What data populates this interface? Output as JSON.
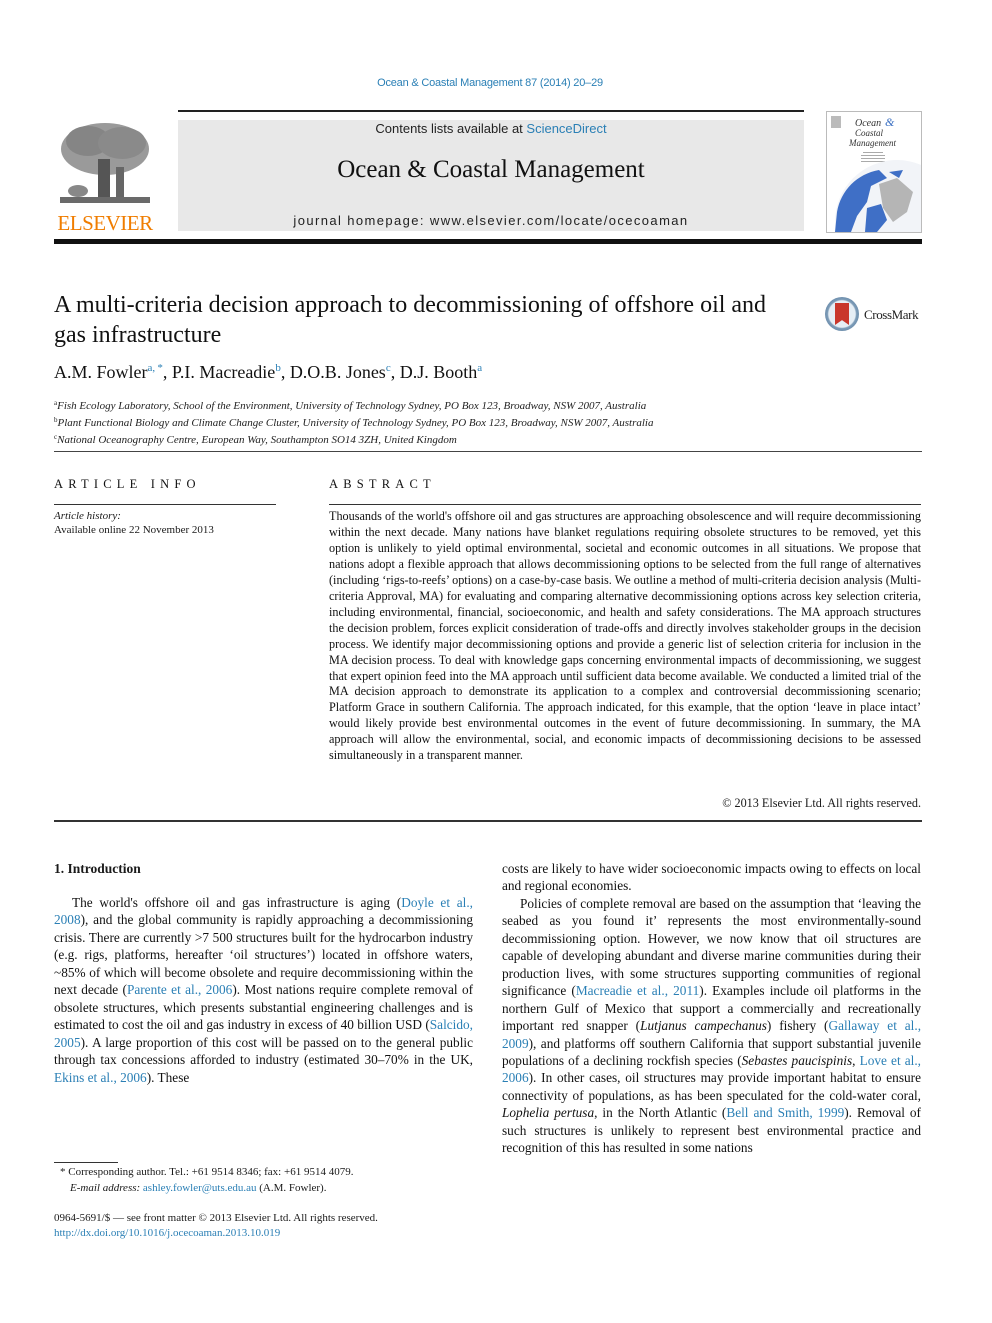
{
  "running_head": "Ocean & Coastal Management 87 (2014) 20–29",
  "masthead": {
    "contents_prefix": "Contents lists available at ",
    "contents_link": "ScienceDirect",
    "journal_title": "Ocean & Coastal Management",
    "homepage": "journal homepage: www.elsevier.com/locate/ocecoaman",
    "publisher_logo_text": "ELSEVIER",
    "cover_title_lines": [
      "Ocean",
      "Coastal",
      "Management"
    ],
    "cover_amp": "&"
  },
  "crossmark_label": "CrossMark",
  "article": {
    "title": "A multi-criteria decision approach to decommissioning of offshore oil and gas infrastructure",
    "authors": [
      {
        "name": "A.M. Fowler",
        "sup": "a, *",
        "sep": ", "
      },
      {
        "name": "P.I. Macreadie",
        "sup": "b",
        "sep": ", "
      },
      {
        "name": "D.O.B. Jones",
        "sup": "c",
        "sep": ", "
      },
      {
        "name": "D.J. Booth",
        "sup": "a",
        "sep": ""
      }
    ],
    "affiliations": [
      {
        "sup": "a",
        "text": "Fish Ecology Laboratory, School of the Environment, University of Technology Sydney, PO Box 123, Broadway, NSW 2007, Australia"
      },
      {
        "sup": "b",
        "text": "Plant Functional Biology and Climate Change Cluster, University of Technology Sydney, PO Box 123, Broadway, NSW 2007, Australia"
      },
      {
        "sup": "c",
        "text": "National Oceanography Centre, European Way, Southampton SO14 3ZH, United Kingdom"
      }
    ]
  },
  "article_info": {
    "heading": "ARTICLE INFO",
    "history_label": "Article history:",
    "history_value": "Available online 22 November 2013"
  },
  "abstract": {
    "heading": "ABSTRACT",
    "text": "Thousands of the world's offshore oil and gas structures are approaching obsolescence and will require decommissioning within the next decade. Many nations have blanket regulations requiring obsolete structures to be removed, yet this option is unlikely to yield optimal environmental, societal and eco­nomic outcomes in all situations. We propose that nations adopt a flexible approach that allows decommissioning options to be selected from the full range of alternatives (including ‘rigs-to-reefs’ options) on a case-by-case basis. We outline a method of multi-criteria decision analysis (Multi-criteria Approval, MA) for evaluating and comparing alternative decommissioning options across key selection criteria, including environmental, financial, socioeconomic, and health and safety considerations. The MA approach structures the decision problem, forces explicit consideration of trade-offs and directly involves stakeholder groups in the decision process. We identify major decommissioning options and provide a generic list of selection criteria for inclusion in the MA decision process. To deal with knowledge gaps concerning environmental impacts of decommissioning, we suggest that expert opinion feed into the MA approach until sufficient data become available. We conducted a limited trial of the MA decision approach to demonstrate its application to a complex and controversial decommissioning scenario; Platform Grace in southern California. The approach indicated, for this example, that the option ‘leave in place intact’ would likely provide best environmental outcomes in the event of future decommissioning. In summary, the MA approach will allow the environmental, social, and economic impacts of decom­missioning decisions to be assessed simultaneously in a transparent manner.",
    "copyright": "© 2013 Elsevier Ltd. All rights reserved."
  },
  "introduction": {
    "heading": "1.  Introduction",
    "left_para": [
      {
        "t": "The world's offshore oil and gas infrastructure is aging ("
      },
      {
        "link": "Doyle et al., 2008"
      },
      {
        "t": "), and the global community is rapidly approaching a decommissioning crisis. There are currently >7 500 structures built for the hydrocarbon industry (e.g. rigs, platforms, hereafter ‘oil structures’) located in offshore waters, ~85% of which will become obsolete and require decommissioning within the next decade ("
      },
      {
        "link": "Parente et al., 2006"
      },
      {
        "t": "). Most nations require complete removal of obsolete structures, which presents substantial engineering chal­lenges and is estimated to cost the oil and gas industry in excess of 40 billion USD ("
      },
      {
        "link": "Salcido, 2005"
      },
      {
        "t": "). A large proportion of this cost will be passed on to the general public through tax concessions afforded to industry (estimated 30–70% in the UK, "
      },
      {
        "link": "Ekins et al., 2006"
      },
      {
        "t": "). These"
      }
    ],
    "right_para1": "costs are likely to have wider socioeconomic impacts owing to ef­fects on local and regional economies.",
    "right_para2": [
      {
        "t": "Policies of complete removal are based on the assumption that ‘leaving the seabed as you found it’ represents the most environmentally-sound decommissioning option. However, we now know that oil structures are capable of developing abundant and diverse marine communities during their production lives, with some structures supporting communities of regional signifi­cance ("
      },
      {
        "link": "Macreadie et al., 2011"
      },
      {
        "t": "). Examples include oil platforms in the northern Gulf of Mexico that support a commercially and recrea­tionally important red snapper ("
      },
      {
        "i": "Lutjanus campechanus"
      },
      {
        "t": ") fishery ("
      },
      {
        "link": "Gallaway et al., 2009"
      },
      {
        "t": "), and platforms off southern California that support substantial juvenile populations of a declining rockfish species ("
      },
      {
        "i": "Sebastes paucispinis"
      },
      {
        "t": ", "
      },
      {
        "link": "Love et al., 2006"
      },
      {
        "t": "). In other cases, oil structures may provide important habitat to ensure connectivity of populations, as has been speculated for the cold-water coral, "
      },
      {
        "i": "Lophelia pertusa"
      },
      {
        "t": ", in the North Atlantic ("
      },
      {
        "link": "Bell and Smith, 1999"
      },
      {
        "t": "). Removal of such structures is unlikely to represent best environ­mental practice and recognition of this has resulted in some nations"
      }
    ]
  },
  "footnote": {
    "corresponding": "*  Corresponding author. Tel.: +61 9514 8346; fax: +61 9514 4079.",
    "email_label": "E-mail address: ",
    "email": "ashley.fowler@uts.edu.au",
    "email_suffix": " (A.M. Fowler)."
  },
  "front_matter": {
    "issn_line": "0964-5691/$ — see front matter © 2013 Elsevier Ltd. All rights reserved.",
    "doi": "http://dx.doi.org/10.1016/j.ocecoaman.2013.10.019"
  },
  "colors": {
    "link": "#2a7fb5",
    "elsevier_orange": "#f07d00",
    "masthead_bg": "#e8e8e8",
    "crossmark_red": "#c9372c"
  }
}
